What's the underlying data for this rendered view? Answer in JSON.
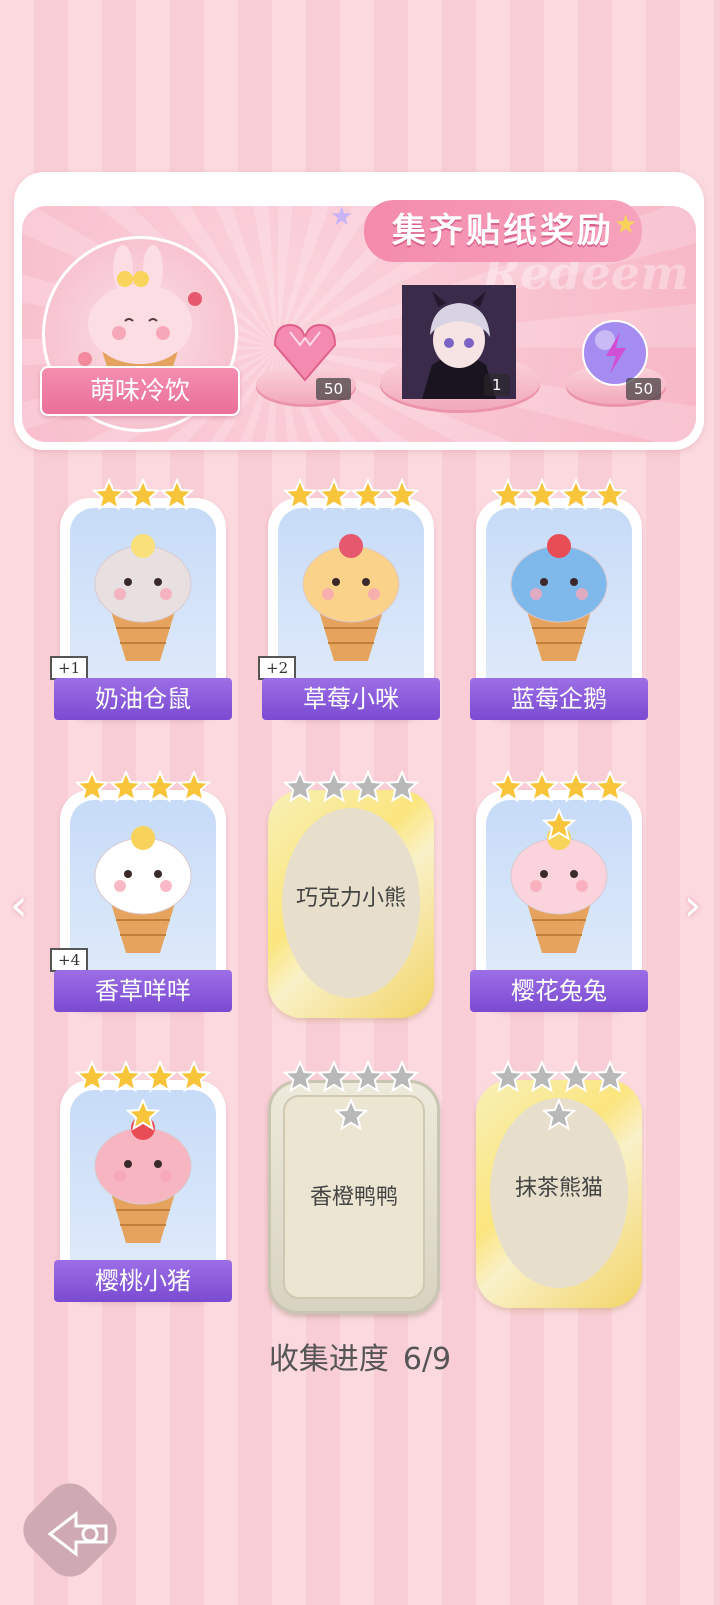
{
  "banner": {
    "title": "集齐贴纸奖励",
    "watermark": "Redeem",
    "theme_label": "萌味冷饮",
    "rewards": [
      {
        "icon": "pink-heart-gem-icon",
        "count": "50"
      },
      {
        "icon": "character-portrait",
        "count": "1"
      },
      {
        "icon": "purple-energy-orb-icon",
        "count": "50"
      }
    ]
  },
  "cards": [
    {
      "name": "奶油仓鼠",
      "stars": 3,
      "collected": true,
      "badge": "+1"
    },
    {
      "name": "草莓小咪",
      "stars": 4,
      "collected": true,
      "badge": "+2"
    },
    {
      "name": "蓝莓企鹅",
      "stars": 4,
      "collected": true,
      "badge": ""
    },
    {
      "name": "香草咩咩",
      "stars": 4,
      "collected": true,
      "badge": "+4"
    },
    {
      "name": "巧克力小熊",
      "stars": 4,
      "collected": false,
      "badge": ""
    },
    {
      "name": "樱花兔兔",
      "stars": 5,
      "collected": true,
      "badge": ""
    },
    {
      "name": "樱桃小猪",
      "stars": 5,
      "collected": true,
      "badge": ""
    },
    {
      "name": "香橙鸭鸭",
      "stars": 5,
      "collected": false,
      "badge": ""
    },
    {
      "name": "抹茶熊猫",
      "stars": 5,
      "collected": false,
      "badge": ""
    }
  ],
  "progress": {
    "label": "收集进度",
    "value": "6/9"
  },
  "colors": {
    "accent": "#7a4bd1",
    "pink": "#f48bab",
    "gold": "#f8c53a",
    "silver": "#b8b8b8"
  }
}
